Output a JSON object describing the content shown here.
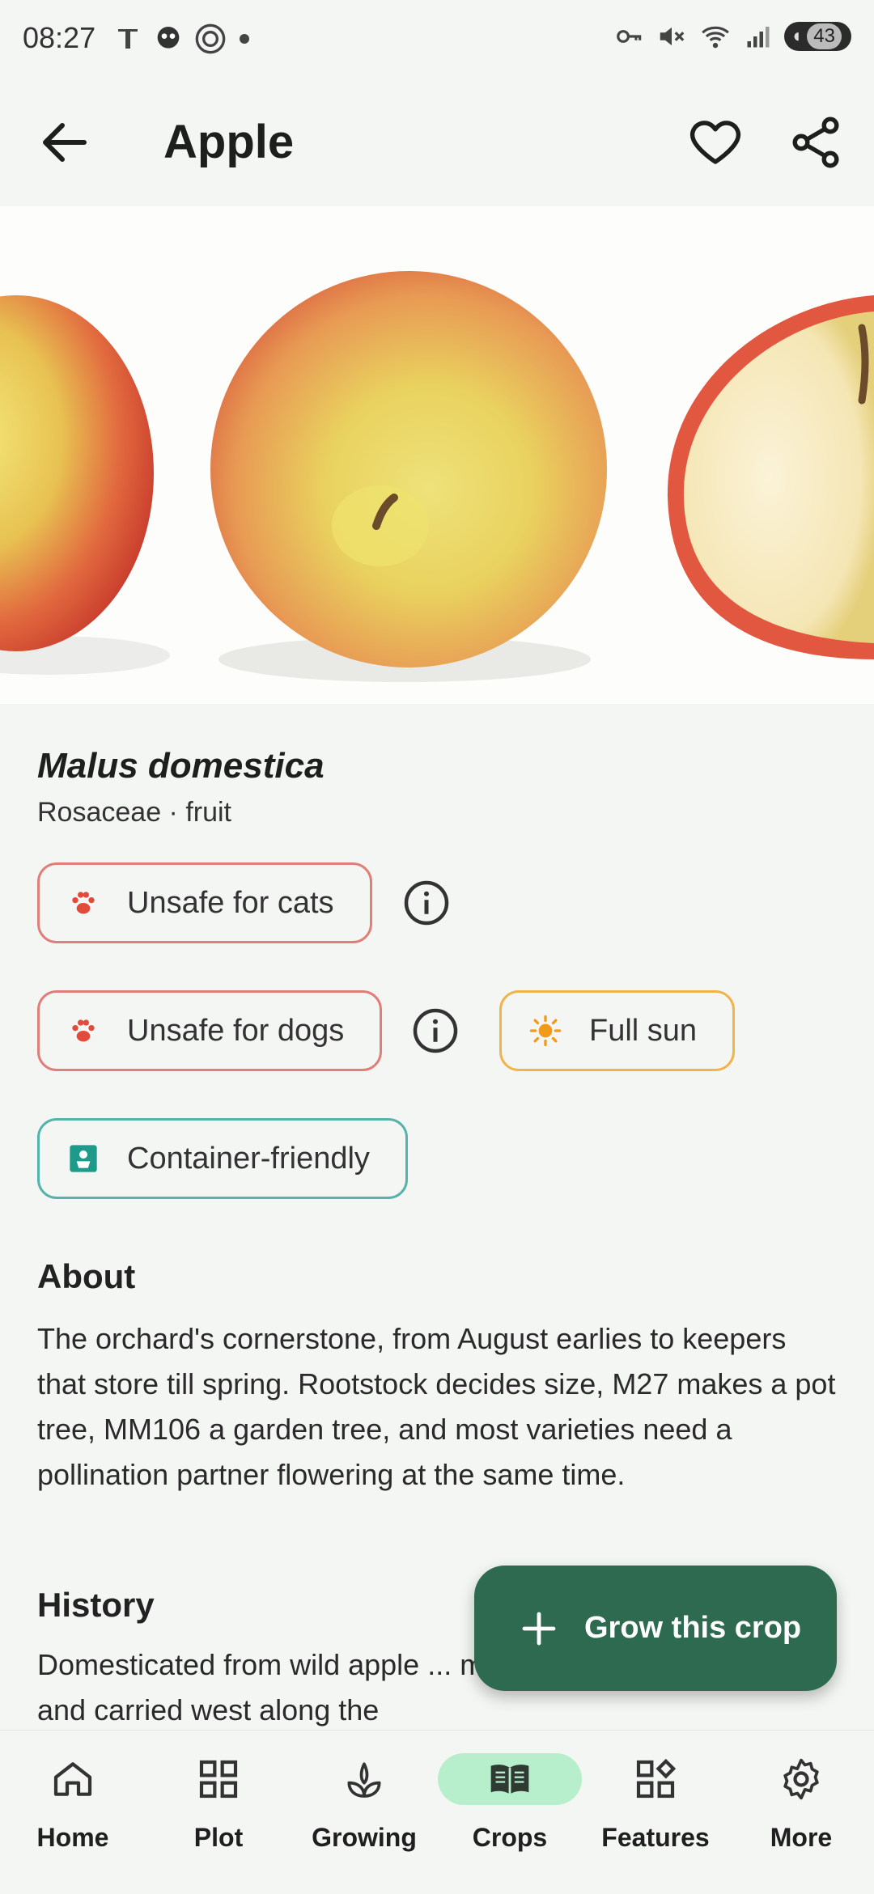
{
  "status": {
    "time": "08:27",
    "battery": "43"
  },
  "appbar": {
    "title": "Apple"
  },
  "plant": {
    "scientific_name": "Malus domestica",
    "family_line": "Rosaceae · fruit"
  },
  "chips": {
    "cats": "Unsafe for cats",
    "dogs": "Unsafe for dogs",
    "sun": "Full sun",
    "container": "Container-friendly"
  },
  "sections": {
    "about_title": "About",
    "about_text": "The orchard's cornerstone, from August earlies to keepers that store till spring. Rootstock decides size, M27 makes a pot tree, MM106 a garden tree, and most varieties need a pollination partner flowering at the same time.",
    "history_title": "History",
    "history_text": "Domesticated from wild apple ... mountains of Kazakhstan and carried west along the"
  },
  "fab": {
    "label": "Grow this crop"
  },
  "nav": {
    "items": [
      {
        "label": "Home",
        "icon": "home-icon"
      },
      {
        "label": "Plot",
        "icon": "grid-icon"
      },
      {
        "label": "Growing",
        "icon": "sprout-icon"
      },
      {
        "label": "Crops",
        "icon": "book-icon",
        "active": true
      },
      {
        "label": "Features",
        "icon": "features-icon"
      },
      {
        "label": "More",
        "icon": "gear-icon"
      }
    ]
  },
  "colors": {
    "primary": "#2d6a4f",
    "active_pill": "#b7efcc",
    "warning_red": "#e07e7a",
    "sun_orange": "#f2b34a",
    "teal": "#55b3aa"
  }
}
